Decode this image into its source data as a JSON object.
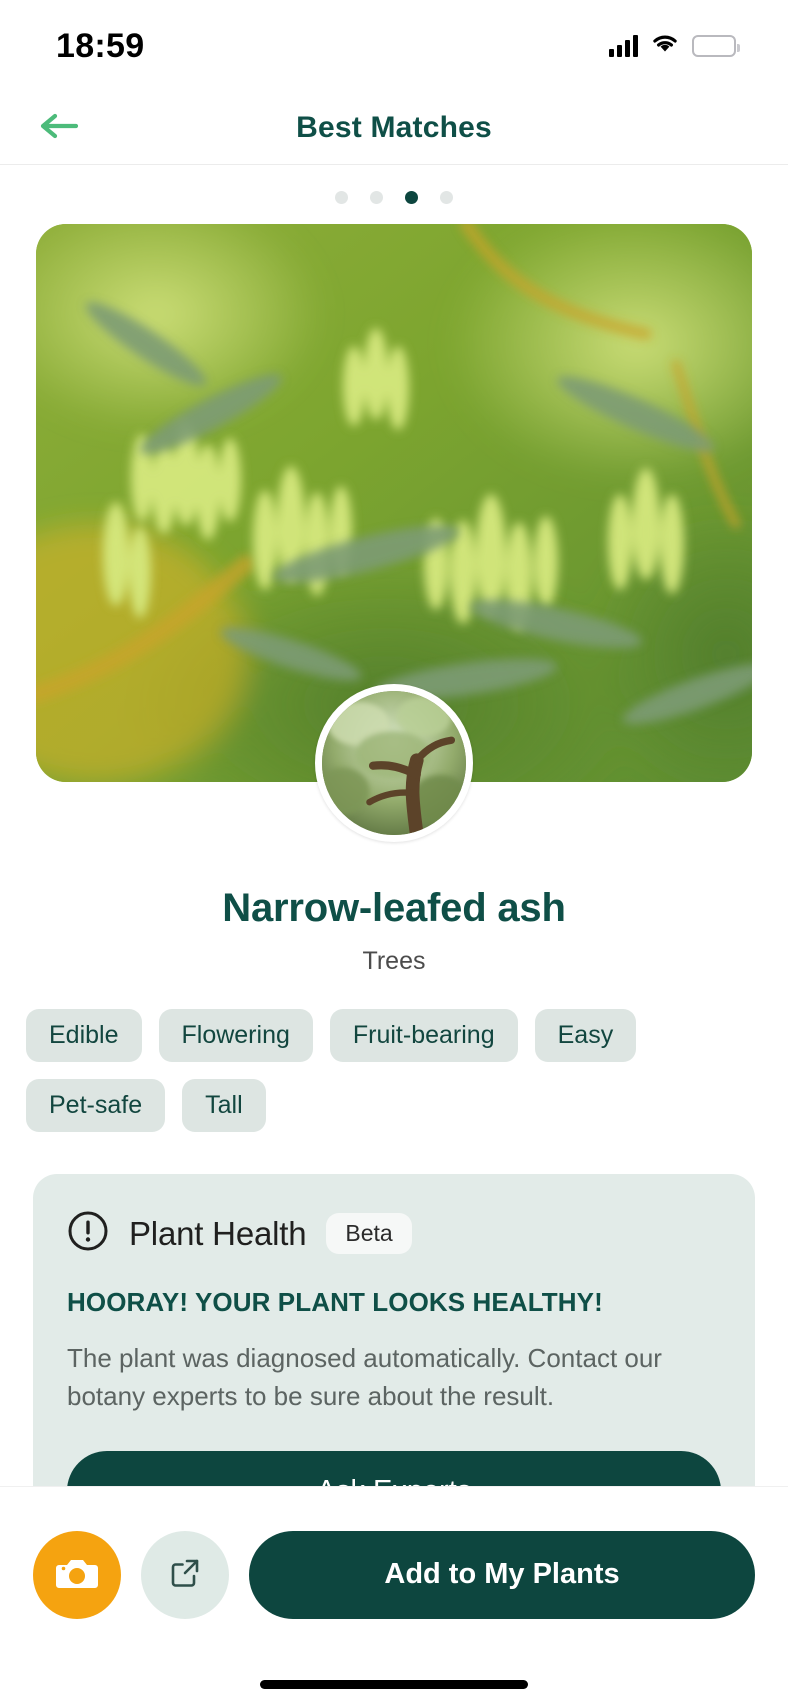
{
  "statusbar": {
    "time": "18:59",
    "signal_icon": "cellular-signal-icon",
    "wifi_icon": "wifi-icon",
    "battery_icon": "battery-low-power-icon"
  },
  "navbar": {
    "title": "Best Matches",
    "back_icon": "arrow-left-icon"
  },
  "carousel": {
    "total": 4,
    "active_index": 2
  },
  "hero": {
    "image_alt": "Narrow-leafed ash branches with green winged seeds",
    "thumb_alt": "Narrow-leafed ash tree trunk and canopy"
  },
  "plant": {
    "name": "Narrow-leafed ash",
    "category": "Trees",
    "tags": [
      "Edible",
      "Flowering",
      "Fruit-bearing",
      "Easy",
      "Pet-safe",
      "Tall"
    ]
  },
  "health": {
    "icon": "exclamation-circle-icon",
    "title": "Plant Health",
    "badge": "Beta",
    "status": "HOORAY! YOUR PLANT LOOKS HEALTHY!",
    "description": "The plant was diagnosed automatically. Contact our botany experts to be sure about the result.",
    "cta_label": "Ask Experts"
  },
  "bottombar": {
    "camera_icon": "camera-icon",
    "share_icon": "share-external-link-icon",
    "add_label": "Add to My Plants"
  },
  "colors": {
    "brand_dark_green": "#0d463f",
    "title_green": "#0f4f47",
    "tag_bg": "#dde5e2",
    "card_bg": "#e2ebe8",
    "camera_orange": "#f5a310",
    "share_bg": "#dfeae6",
    "battery_yellow": "#f7c325",
    "back_arrow_green": "#4cbb7a"
  }
}
